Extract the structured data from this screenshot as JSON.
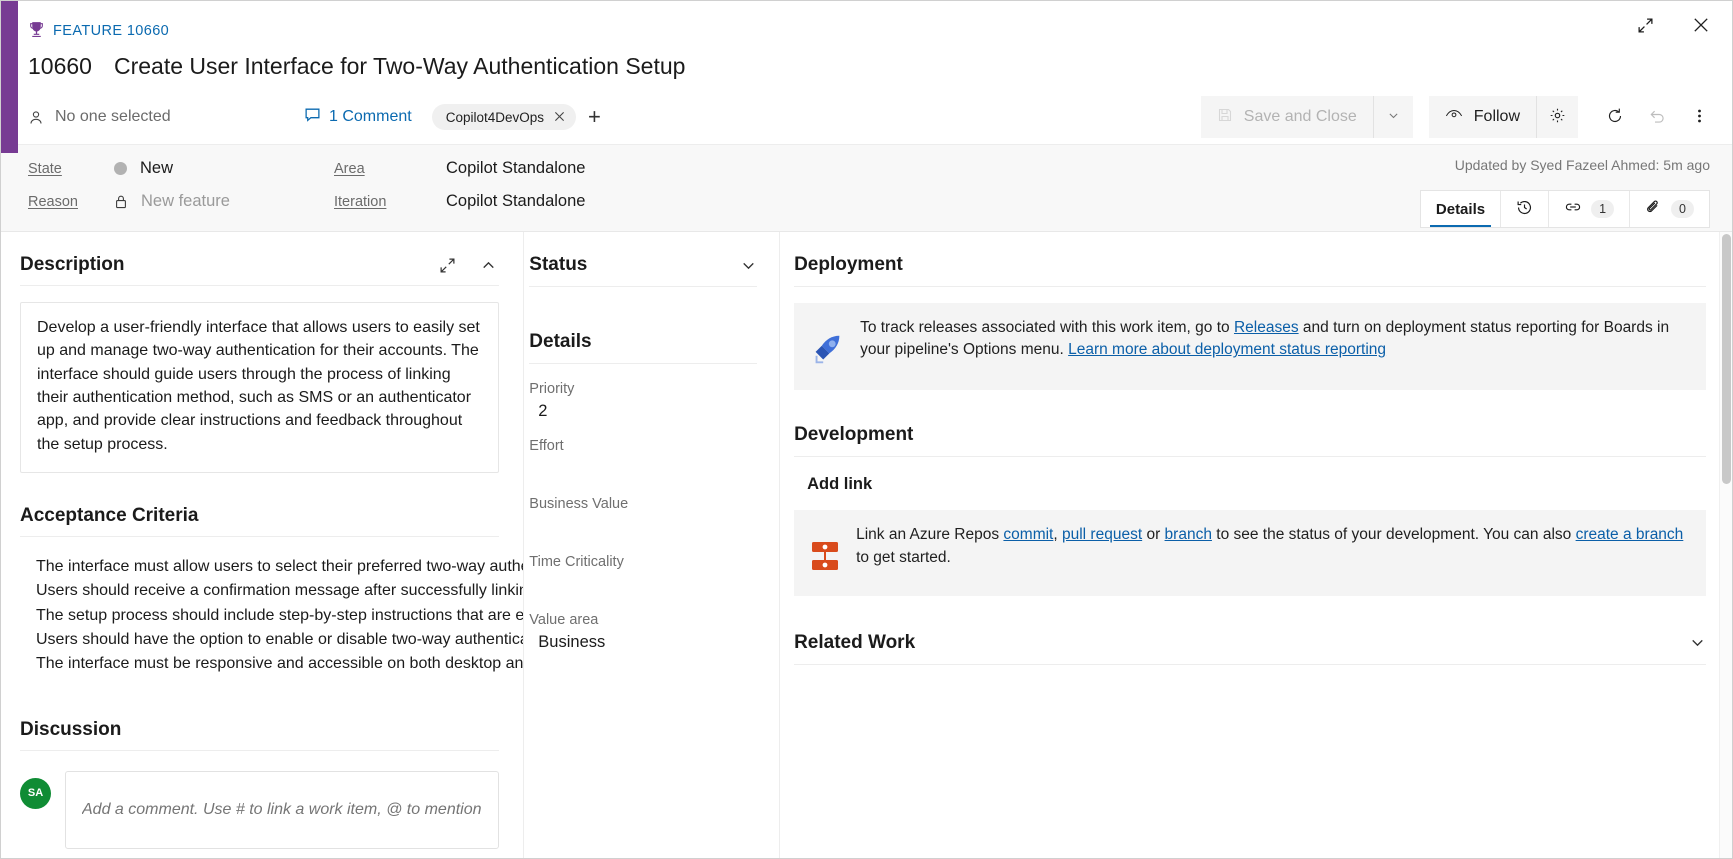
{
  "window": {
    "expand_icon": "expand-icon",
    "close_icon": "close-icon"
  },
  "header": {
    "work_item_type_label": "FEATURE 10660",
    "trophy_icon": "trophy-icon",
    "work_item_id": "10660",
    "title": "Create User Interface for Two-Way Authentication Setup",
    "assigned_to": "No one selected",
    "assigned_icon": "person-icon",
    "comment_count_label": "1 Comment",
    "comment_icon": "comment-icon",
    "tag": "Copilot4DevOps",
    "tag_remove_icon": "close-icon",
    "tag_add_label": "+"
  },
  "toolbar": {
    "save_and_close_label": "Save and Close",
    "save_icon": "save-icon",
    "save_dropdown_icon": "chevron-down-icon",
    "follow_label": "Follow",
    "follow_icon": "eye-icon",
    "settings_icon": "gear-icon",
    "refresh_icon": "refresh-icon",
    "undo_icon": "undo-icon",
    "more_icon": "more-vertical-icon"
  },
  "fields": {
    "state_label": "State",
    "state_value": "New",
    "state_dot_color": "#b2b2b2",
    "reason_label": "Reason",
    "reason_value": "New feature",
    "reason_lock_icon": "lock-icon",
    "area_label": "Area",
    "area_value": "Copilot Standalone",
    "iteration_label": "Iteration",
    "iteration_value": "Copilot Standalone"
  },
  "updated_text": "Updated by Syed Fazeel Ahmed: 5m ago",
  "tabs": [
    {
      "label": "Details",
      "icon": "",
      "count": "",
      "active": true
    },
    {
      "label": "",
      "icon": "history-icon",
      "count": "",
      "active": false
    },
    {
      "label": "",
      "icon": "link-icon",
      "count": "1",
      "active": false
    },
    {
      "label": "",
      "icon": "attachment-icon",
      "count": "0",
      "active": false
    }
  ],
  "description": {
    "title": "Description",
    "expand_icon": "expand-icon",
    "collapse_icon": "chevron-up-icon",
    "text": "Develop a user-friendly interface that allows users to easily set up and manage two-way authentication for their accounts. The interface should guide users through the process of linking their authentication method, such as SMS or an authenticator app, and provide clear instructions and feedback throughout the setup process."
  },
  "acceptance_criteria": {
    "title": "Acceptance Criteria",
    "lines": [
      "The interface must allow users to select their preferred two-way authentication method.",
      "Users should receive a confirmation message after successfully linking their authentication method.",
      "The setup process should include step-by-step instructions that are easy to follow.",
      "Users should have the option to enable or disable two-way authentication at any time.",
      "The interface must be responsive and accessible on both desktop and mobile devices."
    ]
  },
  "discussion": {
    "title": "Discussion",
    "avatar_initials": "SA",
    "avatar_color": "#0f8c34",
    "comment_placeholder": "Add a comment. Use # to link a work item, @ to mention a person, or ! to link a pull request."
  },
  "status_panel": {
    "title": "Status",
    "collapse_icon": "chevron-down-icon"
  },
  "details_panel": {
    "title": "Details",
    "fields": [
      {
        "label": "Priority",
        "value": "2"
      },
      {
        "label": "Effort",
        "value": ""
      },
      {
        "label": "Business Value",
        "value": ""
      },
      {
        "label": "Time Criticality",
        "value": ""
      },
      {
        "label": "Value area",
        "value": "Business"
      }
    ]
  },
  "deployment": {
    "title": "Deployment",
    "icon": "rocket-icon",
    "text_part1": "To track releases associated with this work item, go to ",
    "link1": "Releases",
    "text_part2": " and turn on deployment status reporting for Boards in your pipeline's Options menu. ",
    "link2": "Learn more about deployment status reporting"
  },
  "development": {
    "title": "Development",
    "add_link_label": "Add link",
    "icon": "branch-icon",
    "text_part1": "Link an Azure Repos ",
    "link_commit": "commit",
    "text_comma": ", ",
    "link_pull_request": "pull request",
    "text_or": " or ",
    "link_branch": "branch",
    "text_part2": " to see the status of your development. You can also ",
    "link_create_branch": "create a branch",
    "text_part3": " to get started."
  },
  "related_work": {
    "title": "Related Work",
    "collapse_icon": "chevron-down-icon"
  }
}
